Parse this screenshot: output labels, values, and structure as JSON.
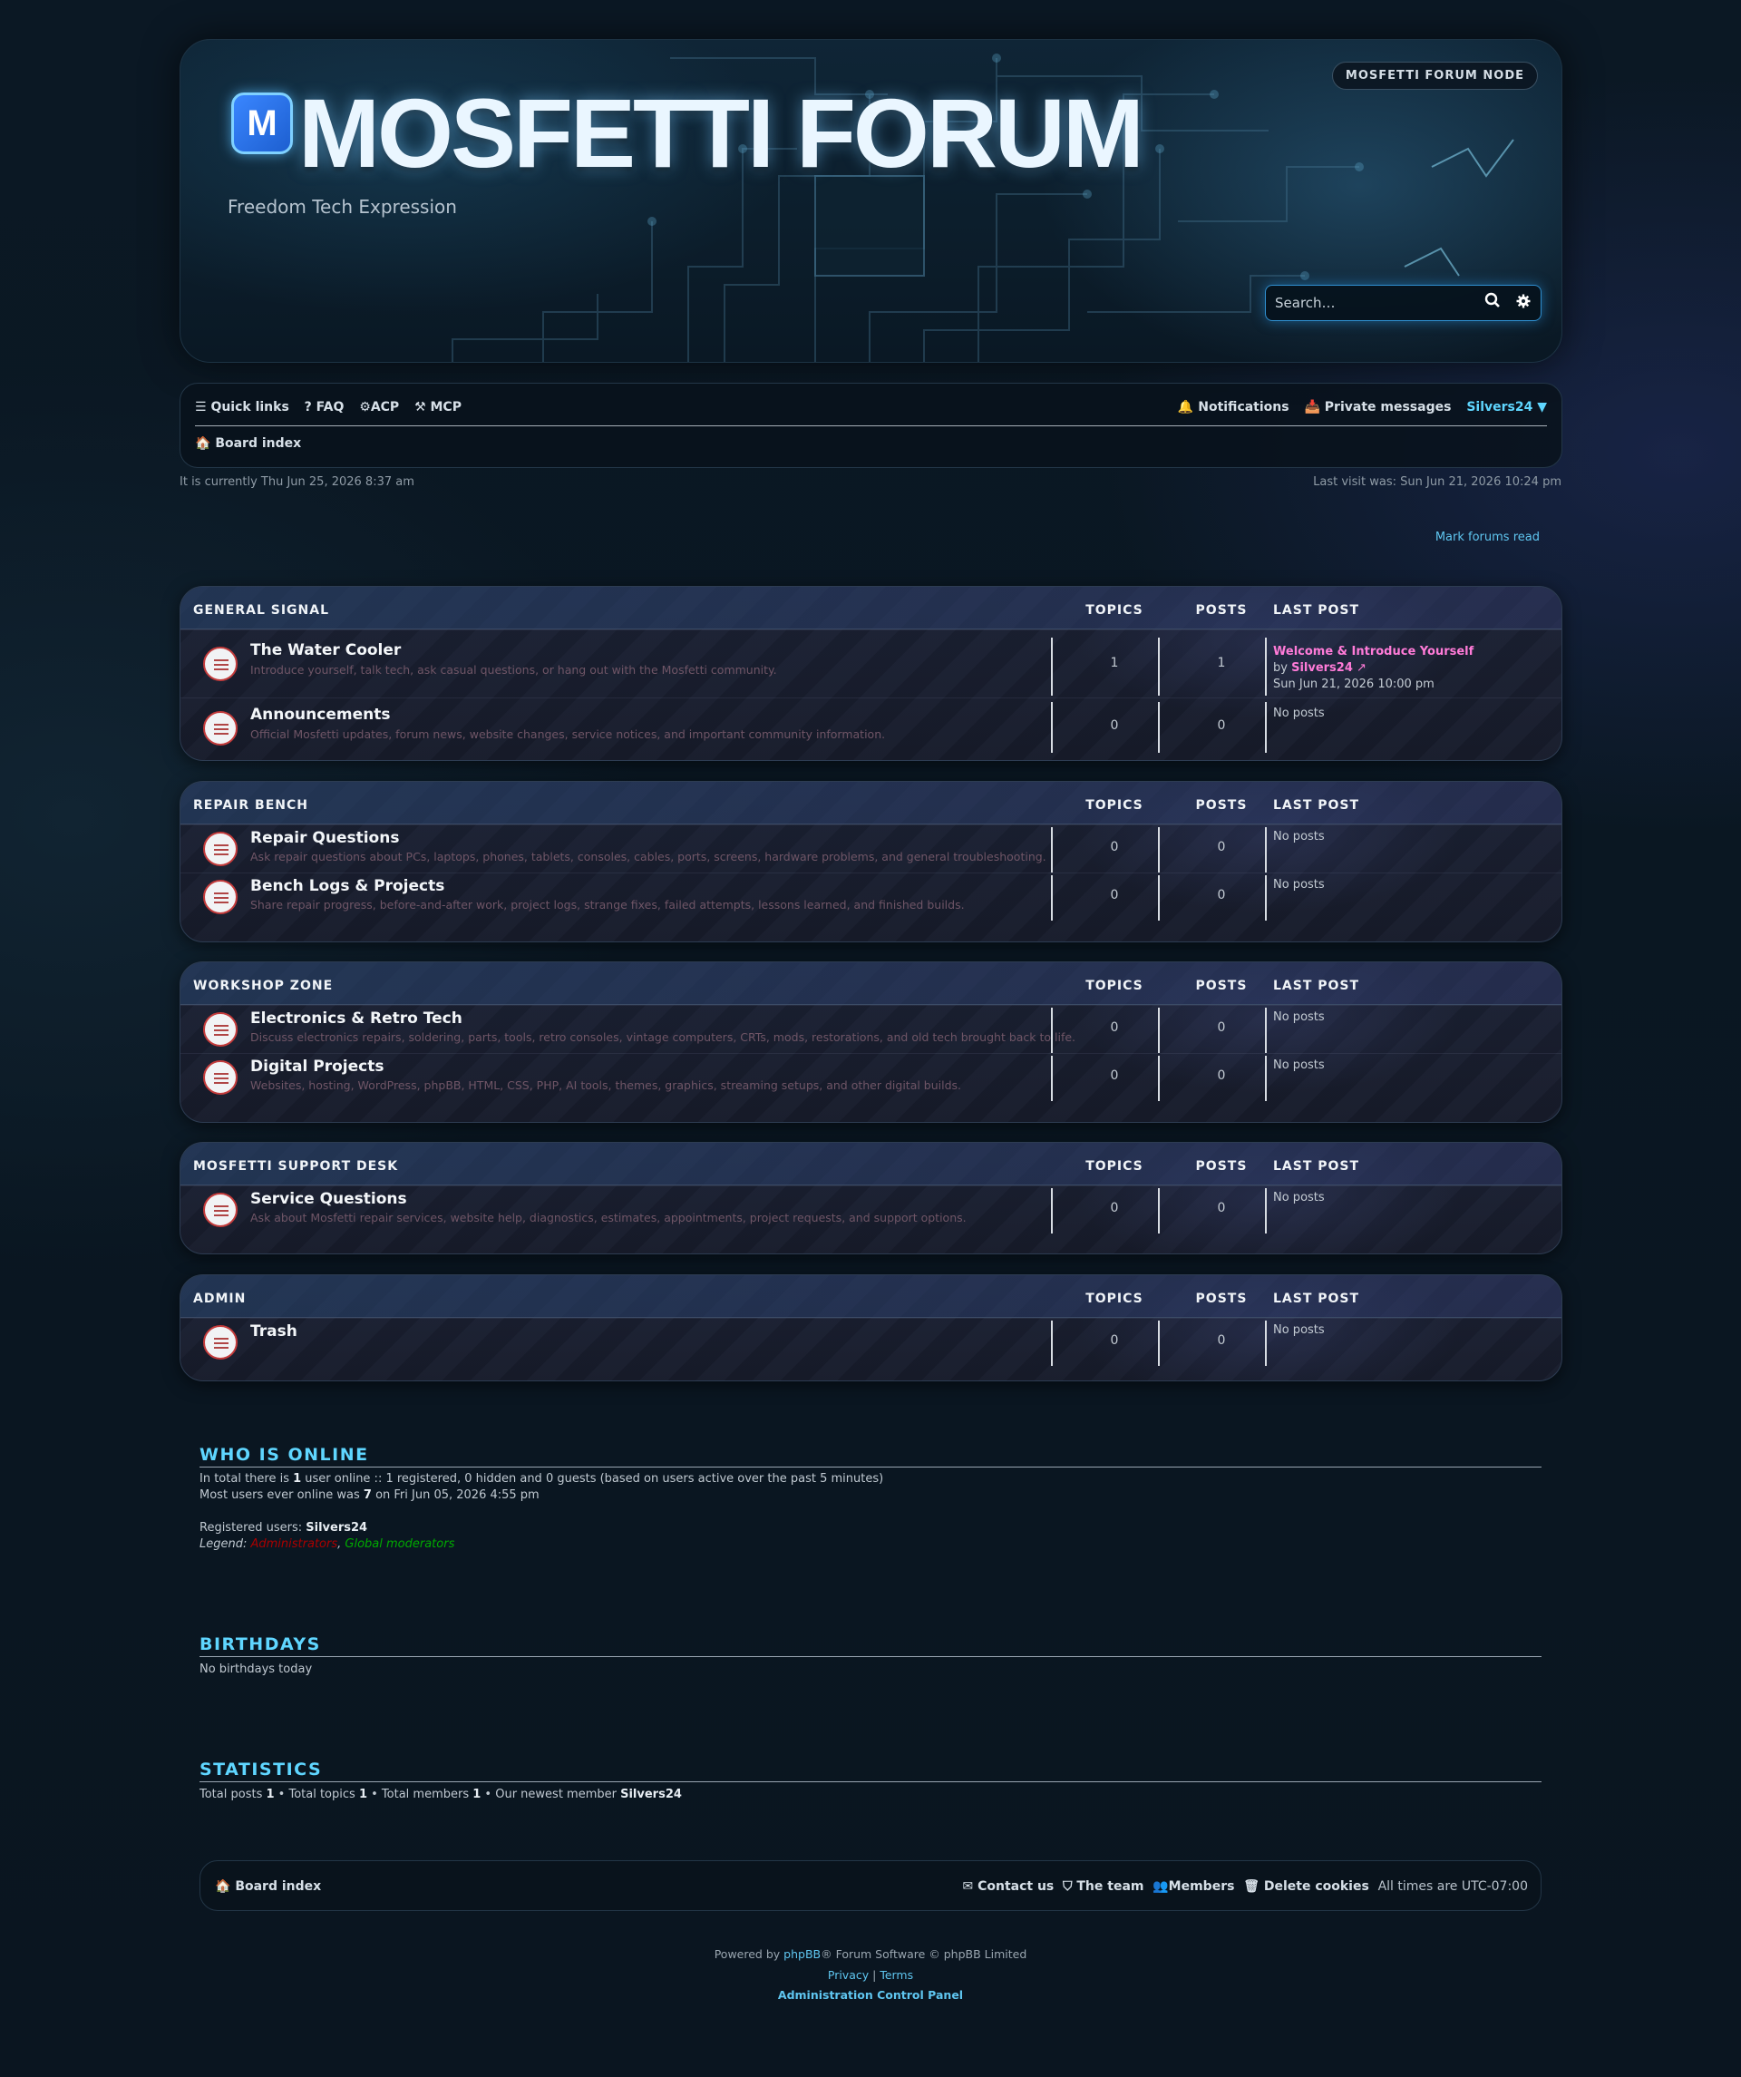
{
  "header": {
    "logo_letter": "M",
    "title": "MOSFETTI FORUM",
    "description": "Freedom Tech Expression",
    "node_badge": "MOSFETTI FORUM NODE",
    "search_placeholder": "Search…"
  },
  "navbar": {
    "quick_links": "Quick links",
    "faq": "FAQ",
    "acp": "ACP",
    "mcp": "MCP",
    "notifications": "Notifications",
    "private_messages": "Private messages",
    "username": "Silvers24",
    "breadcrumb": "Board index"
  },
  "meta": {
    "current_time": "It is currently Thu Jun 25, 2026 8:37 am",
    "last_visit": "Last visit was: Sun Jun 21, 2026 10:24 pm",
    "mark_read": "Mark forums read"
  },
  "columns": {
    "topics": "TOPICS",
    "posts": "POSTS",
    "last_post": "LAST POST"
  },
  "categories": [
    {
      "title": "GENERAL SIGNAL",
      "forums": [
        {
          "name": "The Water Cooler",
          "desc": "Introduce yourself, talk tech, ask casual questions, or hang out with the Mosfetti community.",
          "topics": "1",
          "posts": "1",
          "last_title": "Welcome & Introduce Yourself",
          "last_by": "by ",
          "last_user": "Silvers24",
          "last_date": "Sun Jun 21, 2026 10:00 pm"
        },
        {
          "name": "Announcements",
          "desc": "Official Mosfetti updates, forum news, website changes, service notices, and important community information.",
          "topics": "0",
          "posts": "0",
          "last": "No posts"
        }
      ]
    },
    {
      "title": "REPAIR BENCH",
      "forums": [
        {
          "name": "Repair Questions",
          "desc": "Ask repair questions about PCs, laptops, phones, tablets, consoles, cables, ports, screens, hardware problems, and general troubleshooting.",
          "topics": "0",
          "posts": "0",
          "last": "No posts"
        },
        {
          "name": "Bench Logs & Projects",
          "desc": "Share repair progress, before-and-after work, project logs, strange fixes, failed attempts, lessons learned, and finished builds.",
          "topics": "0",
          "posts": "0",
          "last": "No posts"
        }
      ]
    },
    {
      "title": "WORKSHOP ZONE",
      "forums": [
        {
          "name": "Electronics & Retro Tech",
          "desc": "Discuss electronics repairs, soldering, parts, tools, retro consoles, vintage computers, CRTs, mods, restorations, and old tech brought back to life.",
          "topics": "0",
          "posts": "0",
          "last": "No posts"
        },
        {
          "name": "Digital Projects",
          "desc": "Websites, hosting, WordPress, phpBB, HTML, CSS, PHP, AI tools, themes, graphics, streaming setups, and other digital builds.",
          "topics": "0",
          "posts": "0",
          "last": "No posts"
        }
      ]
    },
    {
      "title": "MOSFETTI SUPPORT DESK",
      "forums": [
        {
          "name": "Service Questions",
          "desc": "Ask about Mosfetti repair services, website help, diagnostics, estimates, appointments, project requests, and support options.",
          "topics": "0",
          "posts": "0",
          "last": "No posts"
        }
      ]
    },
    {
      "title": "ADMIN",
      "forums": [
        {
          "name": "Trash",
          "desc": "",
          "topics": "0",
          "posts": "0",
          "last": "No posts"
        }
      ]
    }
  ],
  "online": {
    "title": "WHO IS ONLINE",
    "line1_a": "In total there is ",
    "line1_b": "1",
    "line1_c": " user online :: 1 registered, 0 hidden and 0 guests (based on users active over the past 5 minutes)",
    "line2_a": "Most users ever online was ",
    "line2_b": "7",
    "line2_c": " on Fri Jun 05, 2026 4:55 pm",
    "registered_label": "Registered users: ",
    "registered_user": "Silvers24",
    "legend_label": "Legend: ",
    "legend_admin": "Administrators",
    "legend_sep": ", ",
    "legend_mods": "Global moderators"
  },
  "birthdays": {
    "title": "BIRTHDAYS",
    "text": "No birthdays today"
  },
  "statistics": {
    "title": "STATISTICS",
    "a": "Total posts ",
    "posts": "1",
    "b": " • Total topics ",
    "topics": "1",
    "c": " • Total members ",
    "members": "1",
    "d": " • Our newest member ",
    "newest": "Silvers24"
  },
  "footer": {
    "board_index": "Board index",
    "contact": "Contact us",
    "team": "The team",
    "members": "Members",
    "delete_cookies": "Delete cookies",
    "timezone": "All times are UTC-07:00",
    "powered_a": "Powered by ",
    "powered_link": "phpBB",
    "powered_b": "® Forum Software © phpBB Limited",
    "privacy": "Privacy",
    "sep": " | ",
    "terms": "Terms",
    "acp_link": "Administration Control Panel"
  },
  "colors": {
    "accent": "#5fd6ff",
    "last_post_link": "#ff7bd8",
    "admin_legend": "#aa0000",
    "mod_legend": "#00aa00"
  }
}
